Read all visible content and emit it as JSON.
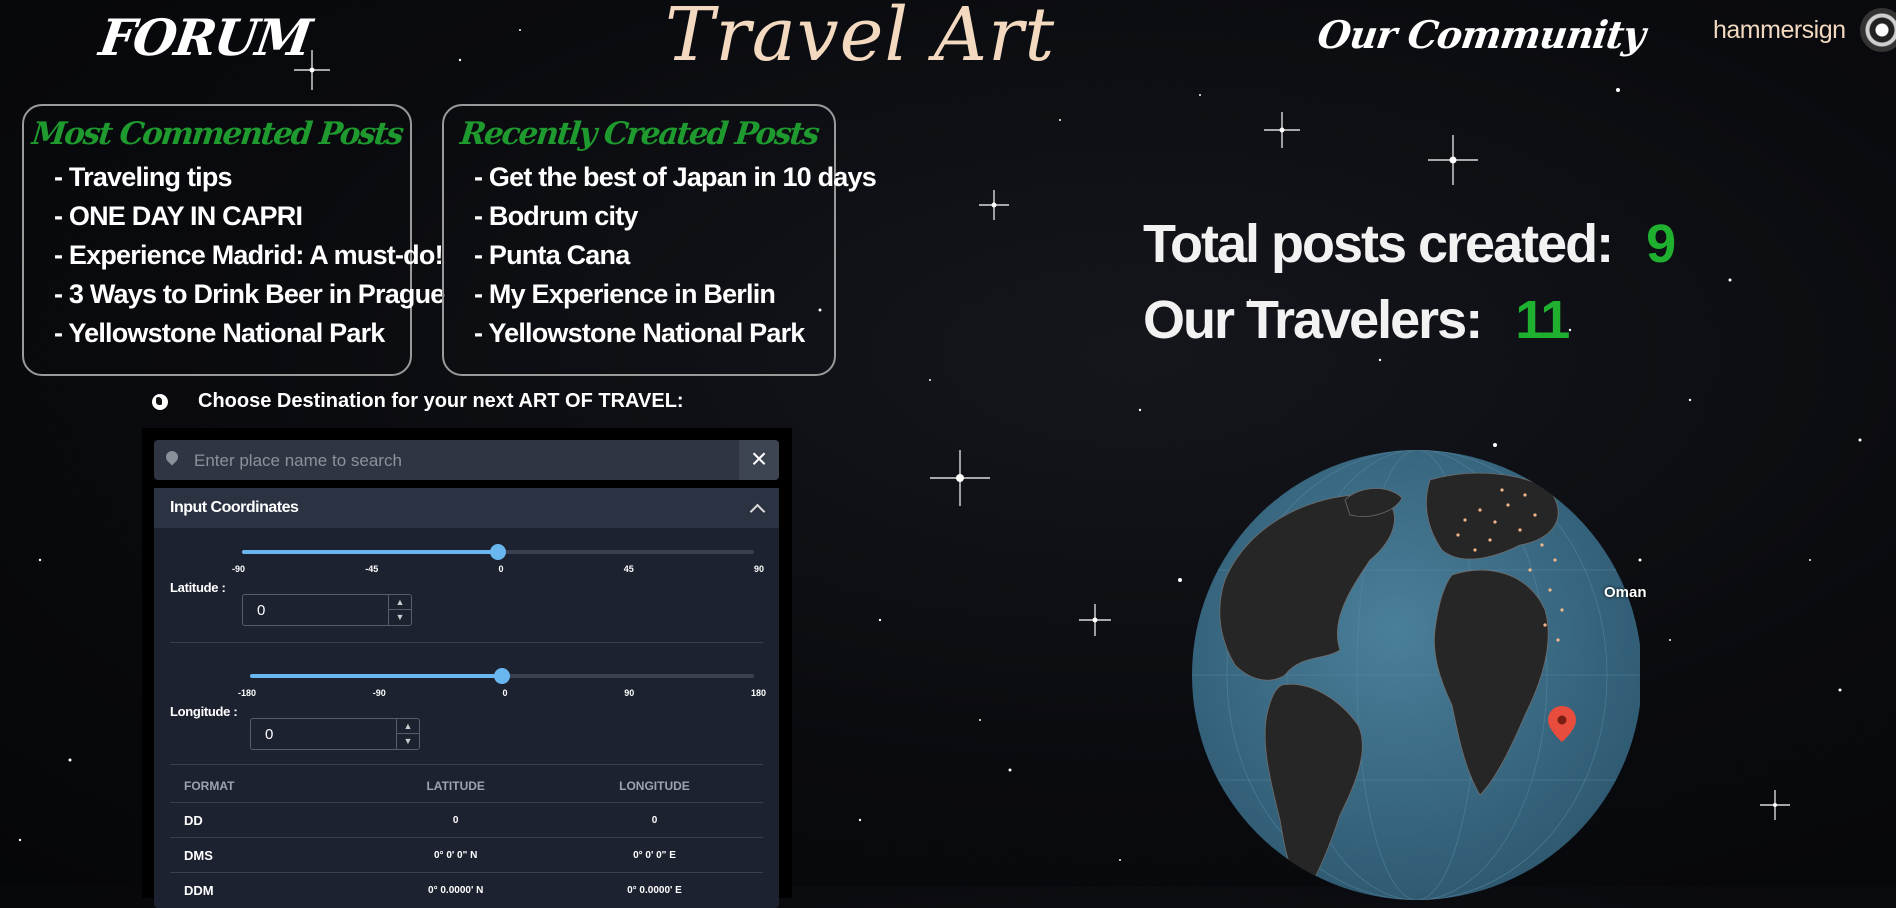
{
  "nav": {
    "forum": "FORUM",
    "title": "Travel Art",
    "community": "Our Community",
    "username": "hammersign"
  },
  "most_commented": {
    "heading": "Most Commented Posts",
    "items": [
      "Traveling tips",
      "ONE DAY IN CAPRI",
      "Experience Madrid: A must-do!",
      "3 Ways to Drink Beer in Prague",
      "Yellowstone National Park"
    ]
  },
  "recent": {
    "heading": "Recently Created Posts",
    "items": [
      "Get the best of Japan in 10 days",
      "Bodrum city",
      "Punta Cana",
      "My Experience in Berlin",
      "Yellowstone National Park"
    ]
  },
  "stats": {
    "posts_label": "Total posts created:",
    "posts_value": "9",
    "travelers_label": "Our Travelers:",
    "travelers_value": "11"
  },
  "destination": {
    "prompt": "Choose Destination for your next ART OF TRAVEL:",
    "search_placeholder": "Enter place name to search",
    "clear_icon": "close-icon",
    "panel_title": "Input Coordinates",
    "latitude": {
      "label": "Latitude :",
      "value": "0",
      "ticks": [
        "-90",
        "-45",
        "0",
        "45",
        "90"
      ],
      "fraction": 0.5
    },
    "longitude": {
      "label": "Longitude :",
      "value": "0",
      "ticks": [
        "-180",
        "-90",
        "0",
        "90",
        "180"
      ],
      "fraction": 0.5
    },
    "table": {
      "headers": [
        "FORMAT",
        "LATITUDE",
        "LONGITUDE"
      ],
      "rows": [
        [
          "DD",
          "0",
          "0"
        ],
        [
          "DMS",
          "0° 0' 0\" N",
          "0° 0' 0\" E"
        ],
        [
          "DDM",
          "0° 0.0000' N",
          "0° 0.0000' E"
        ]
      ]
    }
  },
  "globe": {
    "label": "Oman",
    "ocean_color": "#3e6e88",
    "land_color": "#262626",
    "marker_color": "#e74c3c"
  },
  "colors": {
    "accent_green": "#1fb02f",
    "title_cream": "#f3d9bf"
  }
}
